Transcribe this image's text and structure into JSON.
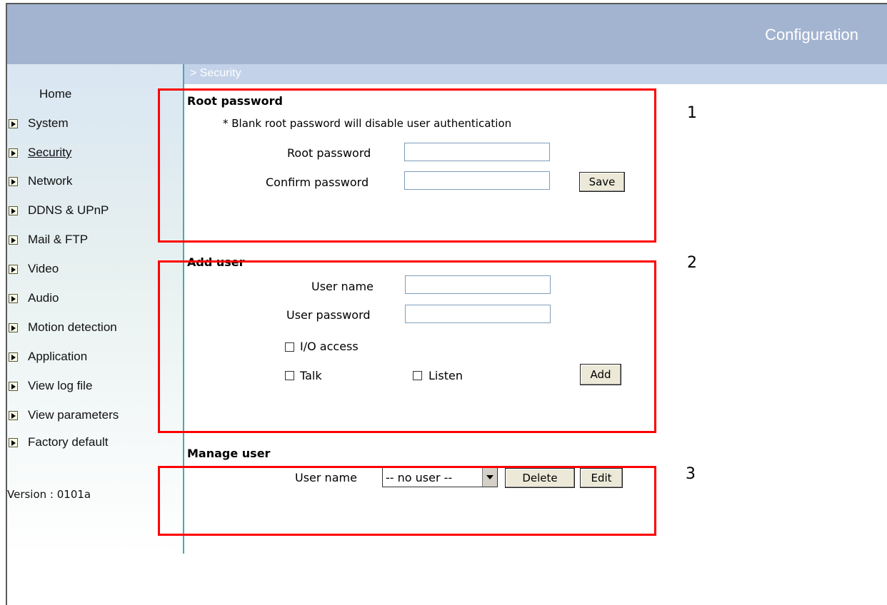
{
  "header": {
    "title": "Configuration"
  },
  "breadcrumb": "> Security",
  "sidebar": {
    "home": "Home",
    "items": [
      {
        "label": "System"
      },
      {
        "label": "Security"
      },
      {
        "label": "Network"
      },
      {
        "label": "DDNS & UPnP"
      },
      {
        "label": "Mail & FTP"
      },
      {
        "label": "Video"
      },
      {
        "label": "Audio"
      },
      {
        "label": "Motion detection"
      },
      {
        "label": "Application"
      },
      {
        "label": "View log file"
      },
      {
        "label": "View parameters"
      },
      {
        "label": "Factory default"
      }
    ],
    "version": "Version : 0101a"
  },
  "root_password": {
    "title": "Root password",
    "note": "* Blank root password will disable user authentication",
    "root_label": "Root password",
    "confirm_label": "Confirm password",
    "root_value": "",
    "confirm_value": "",
    "save_label": "Save"
  },
  "add_user": {
    "title": "Add user",
    "user_name_label": "User name",
    "user_password_label": "User password",
    "user_name_value": "",
    "user_password_value": "",
    "io_access_label": "I/O access",
    "talk_label": "Talk",
    "listen_label": "Listen",
    "add_label": "Add"
  },
  "manage_user": {
    "title": "Manage user",
    "user_name_label": "User name",
    "selected": "-- no user --",
    "delete_label": "Delete",
    "edit_label": "Edit"
  },
  "annotations": {
    "one": "1",
    "two": "2",
    "three": "3"
  },
  "colors": {
    "highlight": "#ff0000",
    "header_bg": "#a3b4d0",
    "crumb_bg": "#c3d2e8",
    "divider": "#4aa8b0"
  }
}
